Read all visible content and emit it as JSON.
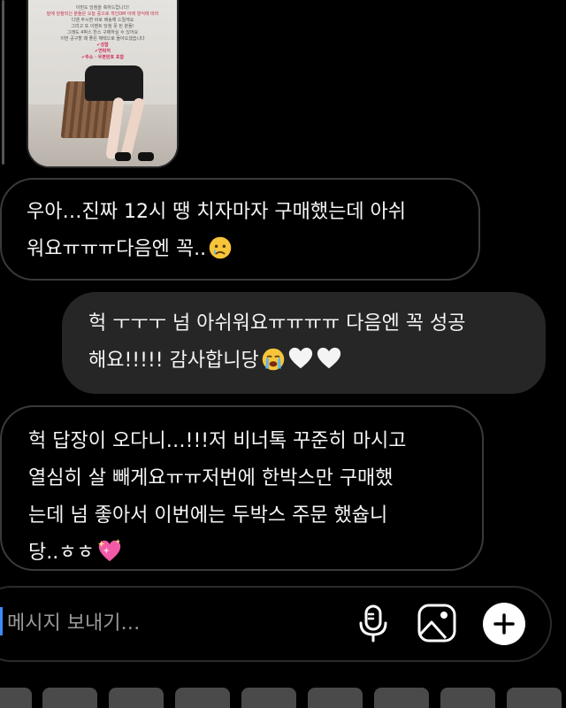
{
  "shared_image": {
    "caption_lines": [
      "이번도 당첨을 축하드립니다!",
      "밑에 당첨되신 분들은 오늘 중으로 개인DM 아래 양식에 따라",
      "디엠 주시면 바로 배송해 드릴게요",
      "그리고 또 이벤트 당첨 못 된 분들!",
      "그래도 4박스 찬스 구매하실 수 있어요",
      "이번 공구할 때 좋은 혜택으로 돌아오겠습니다",
      "✔성함",
      "✔연락처",
      "✔주소 · 우편번호 포함"
    ]
  },
  "messages": [
    {
      "direction": "incoming",
      "lines": [
        "우아…진짜 12시 땡 치자마자 구매했는데 아쉬",
        "워요ㅠㅠㅠ다음엔 꼭.."
      ],
      "emoji": "crying-face"
    },
    {
      "direction": "outgoing",
      "lines": [
        "헉 ㅜㅜㅜ 넘 아쉬워요ㅠㅠㅠㅠ 다음엔 꼭 성공",
        "해요!!!!! 감사합니당"
      ],
      "emoji": [
        "loudly-crying-face",
        "white-heart",
        "white-heart"
      ]
    },
    {
      "direction": "incoming",
      "lines": [
        "헉 답장이 오다니…!!!저 비너톡 꾸준히 마시고",
        "열심히 살 빼게요ㅠㅠ저번에 한박스만 구매했",
        "는데 넘 좋아서 이번에는 두박스 주문 했슙니",
        "당..ㅎㅎ"
      ],
      "emoji": "sparkling-heart"
    }
  ],
  "composer": {
    "placeholder": "메시지 보내기…"
  },
  "colors": {
    "background": "#000000",
    "outgoing_bubble": "#262626",
    "incoming_border": "#3a3a3a",
    "caret": "#3d8bff"
  }
}
